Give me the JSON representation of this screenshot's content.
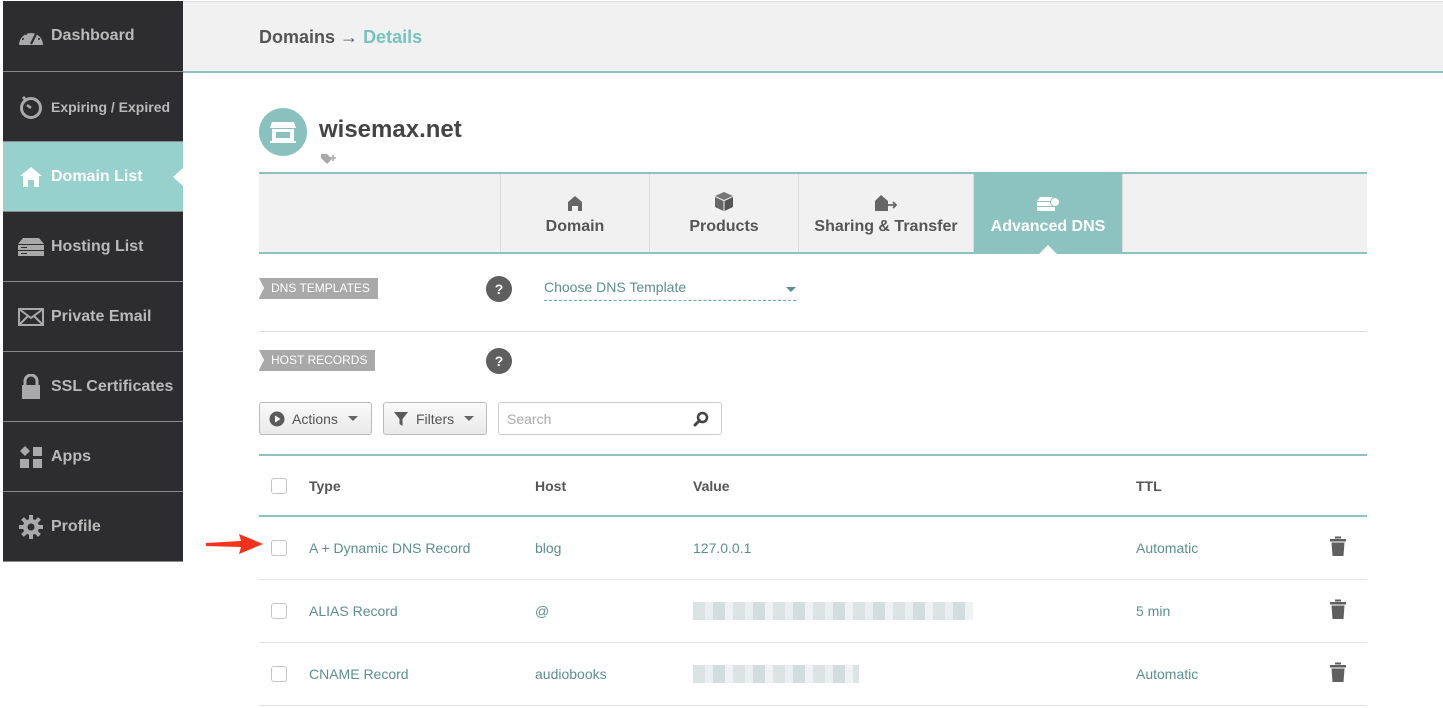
{
  "sidebar": {
    "items": [
      {
        "label": "Dashboard",
        "icon": "speedometer-icon",
        "active": false
      },
      {
        "label": "Expiring / Expired",
        "icon": "stopwatch-icon",
        "active": false
      },
      {
        "label": "Domain List",
        "icon": "home-icon",
        "active": true
      },
      {
        "label": "Hosting List",
        "icon": "server-icon",
        "active": false
      },
      {
        "label": "Private Email",
        "icon": "envelope-icon",
        "active": false
      },
      {
        "label": "SSL Certificates",
        "icon": "lock-icon",
        "active": false
      },
      {
        "label": "Apps",
        "icon": "apps-grid-icon",
        "active": false
      },
      {
        "label": "Profile",
        "icon": "gear-icon",
        "active": false
      }
    ]
  },
  "header": {
    "breadcrumb": {
      "parent": "Domains",
      "separator": "→",
      "current": "Details"
    }
  },
  "domain": {
    "name": "wisemax.net",
    "avatar_icon": "storefront-icon",
    "tag_icon": "add-tag-icon"
  },
  "tabs": [
    {
      "label": "Domain",
      "icon": "home-icon",
      "active": false
    },
    {
      "label": "Products",
      "icon": "box-icon",
      "active": false
    },
    {
      "label": "Sharing & Transfer",
      "icon": "share-home-icon",
      "active": false
    },
    {
      "label": "Advanced DNS",
      "icon": "dns-server-icon",
      "active": true
    }
  ],
  "dns_templates": {
    "label": "DNS TEMPLATES",
    "help": "?",
    "select_value": "Choose DNS Template"
  },
  "host_records": {
    "label": "HOST RECORDS",
    "help": "?"
  },
  "toolbar": {
    "actions_label": "Actions",
    "filters_label": "Filters",
    "search_placeholder": "Search",
    "search_value": ""
  },
  "table": {
    "columns": [
      "Type",
      "Host",
      "Value",
      "TTL"
    ],
    "rows": [
      {
        "type": "A + Dynamic DNS Record",
        "host": "blog",
        "value": "127.0.0.1",
        "value_obscured": false,
        "ttl": "Automatic",
        "checked": false,
        "highlighted_by_arrow": true
      },
      {
        "type": "ALIAS Record",
        "host": "@",
        "value": "",
        "value_obscured": true,
        "ttl": "5 min",
        "checked": false,
        "highlighted_by_arrow": false
      },
      {
        "type": "CNAME Record",
        "host": "audiobooks",
        "value": "",
        "value_obscured": true,
        "ttl": "Automatic",
        "checked": false,
        "highlighted_by_arrow": false
      }
    ]
  },
  "colors": {
    "accent": "#8cc3c0",
    "sidebar_bg": "#2d2d2f",
    "sidebar_active": "#97d1cd",
    "link_text": "#5c8f8c",
    "annotation_arrow": "#f5321b"
  }
}
